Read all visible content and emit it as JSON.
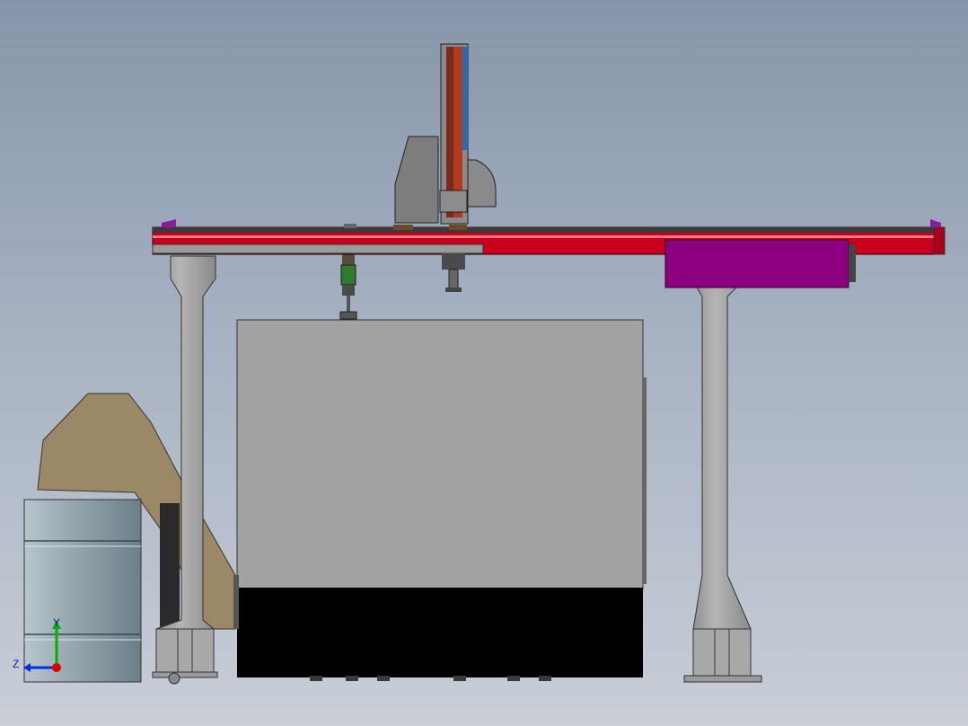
{
  "scene": {
    "kind": "3D CAD render, side view of gantry robot cell",
    "colors": {
      "background_top": "#8795aa",
      "background_bottom": "#c9ced7",
      "frame_grey": "#a3a3a3",
      "beam_red": "#c8001e",
      "cabinet_magenta": "#8c0080",
      "machine_grey": "#a2a2a2",
      "machine_base": "#000000",
      "chute_tan": "#9a8867",
      "drum_blue_grey": "#8d9ea7"
    }
  },
  "triad": {
    "y_label": "Y",
    "z_label": "Z",
    "x_color": "#e00000",
    "y_color": "#00b000",
    "z_color": "#0030e0"
  }
}
